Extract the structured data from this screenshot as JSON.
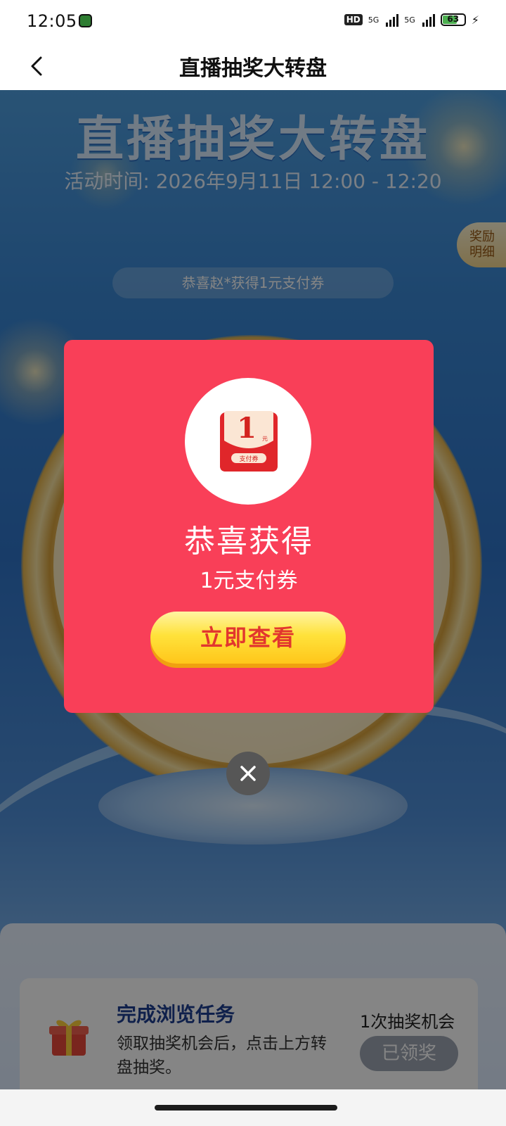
{
  "status_bar": {
    "time": "12:05",
    "network_badge": "HD",
    "signal1_label": "5G",
    "signal2_label": "5G",
    "battery_level": "63",
    "charging_icon": "bolt-icon"
  },
  "nav": {
    "title": "直播抽奖大转盘",
    "back_icon": "chevron-left-icon"
  },
  "hero": {
    "title": "直播抽奖大转盘",
    "time": "活动时间: 2026年9月11日 12:00 - 12:20"
  },
  "reward_tab": {
    "line1": "奖励",
    "line2": "明细"
  },
  "marquee": {
    "text": "恭喜赵*获得1元支付券"
  },
  "task": {
    "title": "完成浏览任务",
    "description": "领取抽奖机会后，点击上方转盘抽奖。",
    "chance": "1次抽奖机会",
    "button": "已领奖",
    "icon": "gift-icon"
  },
  "modal": {
    "coupon_amount": "1",
    "coupon_unit": "元",
    "coupon_label": "支付券",
    "title": "恭喜获得",
    "subtitle": "1元支付券",
    "button": "立即查看",
    "close_icon": "close-icon"
  },
  "colors": {
    "modal_bg": "#f93f58",
    "button_text": "#e2362e",
    "button_yellow": "#ffe23b",
    "task_title": "#1d3f91"
  }
}
